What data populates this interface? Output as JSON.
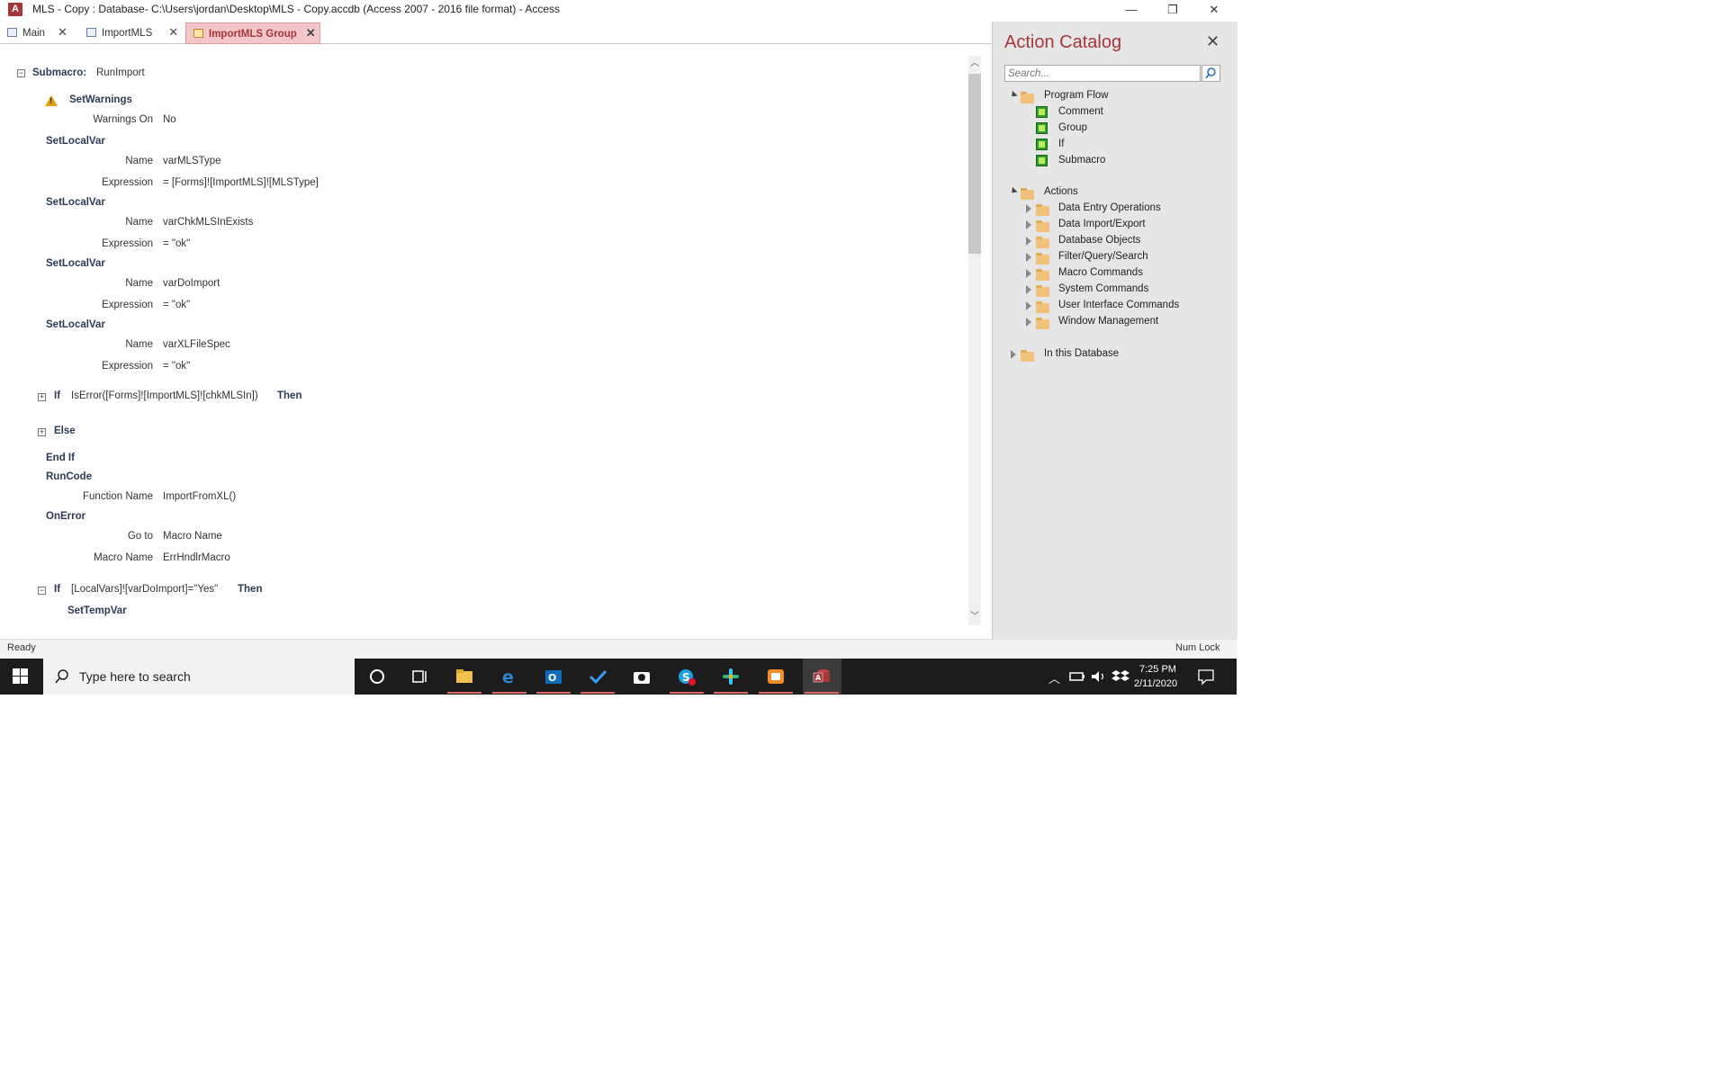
{
  "window": {
    "title": "MLS - Copy : Database- C:\\Users\\jordan\\Desktop\\MLS - Copy.accdb (Access 2007 - 2016 file format) - Access",
    "minimize": "—",
    "restore": "❐",
    "close": "✕"
  },
  "tabs": [
    {
      "label": "Main",
      "close": "✕"
    },
    {
      "label": "ImportMLS",
      "close": "✕"
    },
    {
      "label": "ImportMLS Group",
      "close": "✕"
    }
  ],
  "macro": {
    "submacro_kw": "Submacro:",
    "submacro_name": "RunImport",
    "setwarnings": "SetWarnings",
    "warnings_on_label": "Warnings On",
    "warnings_on_value": "No",
    "setlocalvar": "SetLocalVar",
    "name_label": "Name",
    "expression_label": "Expression",
    "var1_name": "varMLSType",
    "var1_expr": "= [Forms]![ImportMLS]![MLSType]",
    "var2_name": "varChkMLSInExists",
    "var2_expr": "= \"ok\"",
    "var3_name": "varDoImport",
    "var3_expr": "= \"ok\"",
    "var4_name": "varXLFileSpec",
    "var4_expr": "= \"ok\"",
    "if_kw": "If",
    "if1_cond": "IsError([Forms]![ImportMLS]![chkMLSIn])",
    "then_kw": "Then",
    "else_kw": "Else",
    "endif_kw": "End If",
    "runcode": "RunCode",
    "function_name_label": "Function Name",
    "function_name_value": "ImportFromXL()",
    "onerror": "OnError",
    "goto_label": "Go to",
    "goto_value": "Macro Name",
    "macro_name_label": "Macro Name",
    "macro_name_value": "ErrHndlrMacro",
    "if2_cond": "[LocalVars]![varDoImport]=\"Yes\"",
    "settempvar": "SetTempVar"
  },
  "catalog": {
    "title": "Action Catalog",
    "close": "✕",
    "search_placeholder": "Search...",
    "program_flow": "Program Flow",
    "pf_items": [
      "Comment",
      "Group",
      "If",
      "Submacro"
    ],
    "actions": "Actions",
    "action_items": [
      "Data Entry Operations",
      "Data Import/Export",
      "Database Objects",
      "Filter/Query/Search",
      "Macro Commands",
      "System Commands",
      "User Interface Commands",
      "Window Management"
    ],
    "in_this_db": "In this Database"
  },
  "status": {
    "left": "Ready",
    "right": "Num Lock"
  },
  "taskbar": {
    "search_placeholder": "Type here to search",
    "time": "7:25 PM",
    "date": "2/11/2020"
  },
  "colors": {
    "accent": "#a4373a",
    "tab_active_bg": "#f3c6c9",
    "taskbar": "#1c1c1c"
  }
}
